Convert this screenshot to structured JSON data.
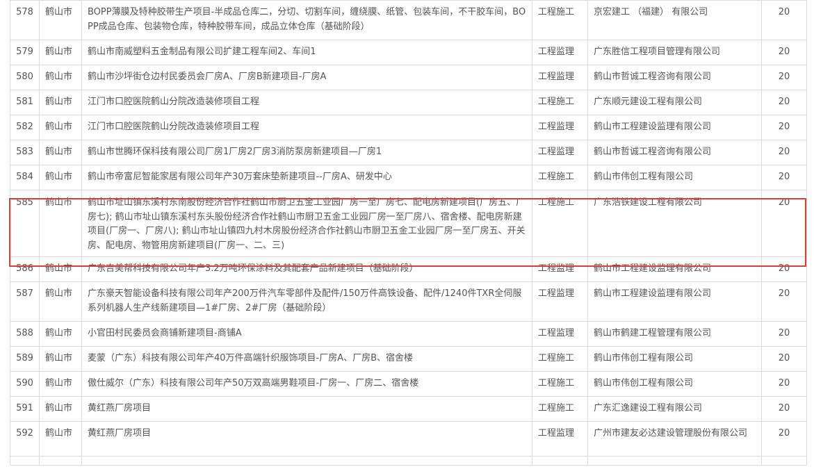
{
  "rows": [
    {
      "no": "578",
      "city": "鹤山市",
      "project": "BOPP薄膜及特种胶带生产项目-半成品仓库二，分切、切割车间，缠绕膜、纸管、包装车间，不干胶车间，BOPP成品仓库、包装物仓库，特种胶带车间，成品立体仓库（基础阶段）",
      "type": "工程施工",
      "company": "京宏建工 （福建） 有限公司",
      "score": "20"
    },
    {
      "no": "579",
      "city": "鹤山市",
      "project": "鹤山市南威塑料五金制品有限公司扩建工程车间2、车间1",
      "type": "工程监理",
      "company": "广东胜信工程项目管理有限公司",
      "score": "20"
    },
    {
      "no": "580",
      "city": "鹤山市",
      "project": "鹤山市沙坪街仓边村民委员会厂房A、厂房B新建项目-厂房A",
      "type": "工程监理",
      "company": "鹤山市哲诚工程咨询有限公司",
      "score": "20"
    },
    {
      "no": "581",
      "city": "鹤山市",
      "project": "江门市口腔医院鹤山分院改造装修项目工程",
      "type": "工程施工",
      "company": "广东顺元建设工程有限公司",
      "score": "20"
    },
    {
      "no": "582",
      "city": "鹤山市",
      "project": "江门市口腔医院鹤山分院改造装修项目工程",
      "type": "工程监理",
      "company": "鹤山市工程建设监理有限公司",
      "score": "20"
    },
    {
      "no": "583",
      "city": "鹤山市",
      "project": "鹤山市世腾环保科技有限公司厂房1厂房2厂房3消防泵房新建项目—厂房1",
      "type": "工程监理",
      "company": "鹤山市哲诚工程咨询有限公司",
      "score": "20"
    },
    {
      "no": "584",
      "city": "鹤山市",
      "project": "鹤山市帝富尼智能家居有限公司年产30万套床垫新建项目--厂房A、研发中心",
      "type": "工程施工",
      "company": "鹤山市伟创工程有限公司",
      "score": "20"
    },
    {
      "no": "585",
      "city": "鹤山市",
      "project": "鹤山市址山镇东溪村东南股份经济合作社鹤山市厨卫五金工业园厂房一至厂房七、配电房新建项目(厂房五、厂房七); 鹤山市址山镇东溪村东头股份经济合作社鹤山市厨卫五金工业园厂房一至厂房八、宿舍楼、配电房新建项目(厂房一、厂房八); 鹤山市址山镇四九村木房股份经济合作社鹤山市厨卫五金工业园厂房一至厂房五、开关房、配电房、物管用房新建项目(厂房一、二、三)",
      "type": "工程施工",
      "company": "广东浩铁建设工程有限公司",
      "score": "20"
    },
    {
      "no": "586",
      "city": "鹤山市",
      "project": "广东吉美帮科技有限公司年产3.2万吨环保涂料及其配套产品新建项目（基础阶段）",
      "type": "工程监理",
      "company": "鹤山市工程建设监理有限公司",
      "score": "20"
    },
    {
      "no": "587",
      "city": "鹤山市",
      "project": "广东豪天智能设备科技有限公司年产200万件汽车零部件及配件/150万件高铁设备、配件/1240件TXR全伺服系列机器人生产线新建项目—1#厂房、2#厂房（基础阶段）",
      "type": "工程监理",
      "company": "鹤山市工程建设监理有限公司",
      "score": "20"
    },
    {
      "no": "588",
      "city": "鹤山市",
      "project": "小官田村民委员会商铺新建项目-商铺A",
      "type": "工程监理",
      "company": "鹤山市鹤建工程管理有限公司",
      "score": "20"
    },
    {
      "no": "589",
      "city": "鹤山市",
      "project": "麦蒙（广东）科技有限公司年产40万件高端针织服饰项目-厂房A、厂房B、宿舍楼",
      "type": "工程施工",
      "company": "鹤山市伟创工程有限公司",
      "score": "20"
    },
    {
      "no": "590",
      "city": "鹤山市",
      "project": "傲仕威尔（广东）科技有限公司年产50万双高端男鞋项目-厂房一、厂房二、宿舍楼",
      "type": "工程施工",
      "company": "鹤山市伟创工程有限公司",
      "score": "20"
    },
    {
      "no": "591",
      "city": "鹤山市",
      "project": "黄红燕厂房项目",
      "type": "工程施工",
      "company": "广东汇逸建设工程有限公司",
      "score": "20"
    },
    {
      "no": "592",
      "city": "鹤山市",
      "project": "黄红燕厂房项目",
      "type": "工程监理",
      "company": "广州市建友必达建设管理股份有限公司",
      "score": "20"
    }
  ]
}
